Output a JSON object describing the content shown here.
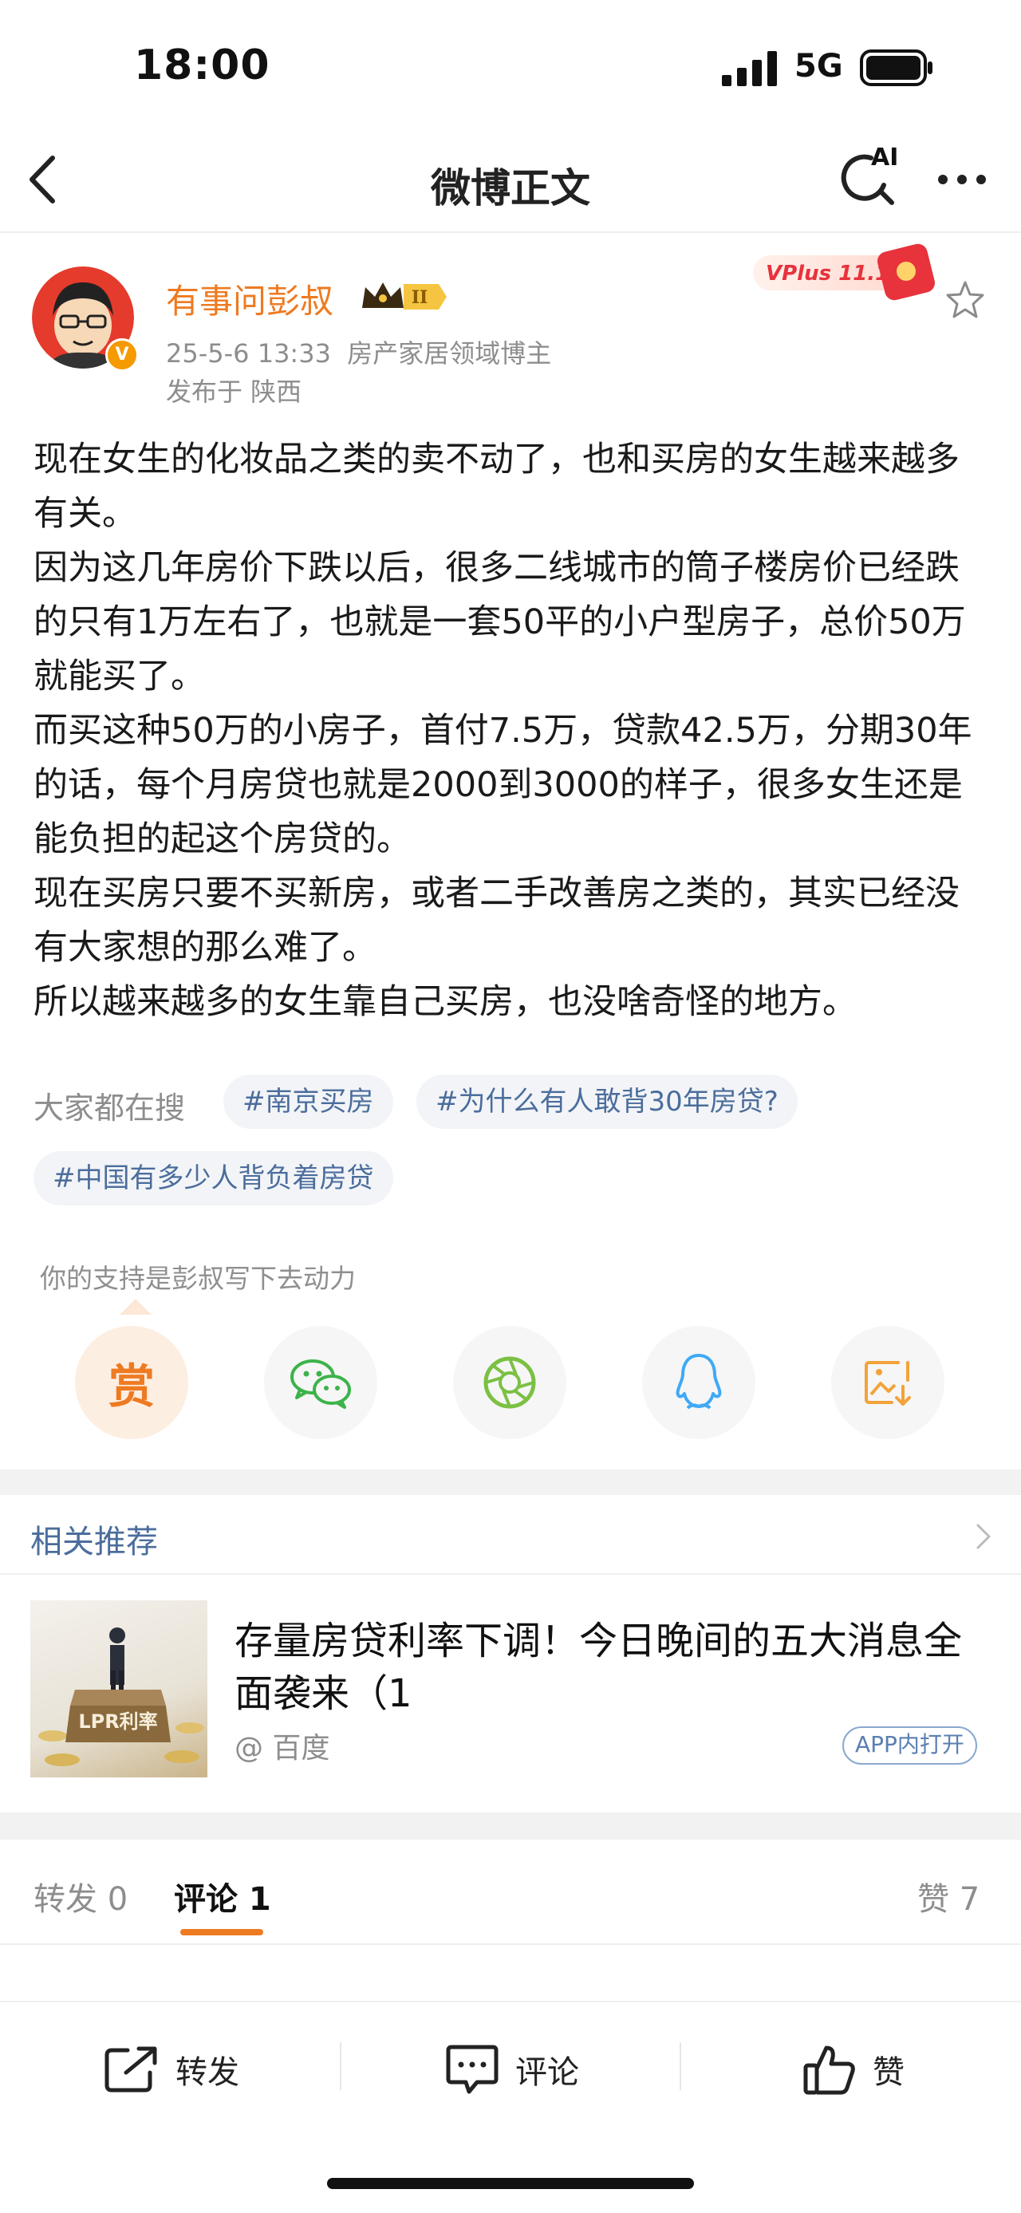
{
  "status_bar": {
    "time": "18:00",
    "network": "5G"
  },
  "nav": {
    "title": "微博正文",
    "ai_label": "AI"
  },
  "author": {
    "name": "有事问彭叔",
    "level_badge": "II",
    "verified_badge": "V",
    "timestamp": "25-5-6 13:33",
    "tagline": "房产家居领域博主",
    "location": "发布于 陕西",
    "promo_badge": "VPlus 11.11"
  },
  "post": {
    "paragraphs": [
      "现在女生的化妆品之类的卖不动了，也和买房的女生越来越多有关。",
      "因为这几年房价下跌以后，很多二线城市的筒子楼房价已经跌的只有1万左右了，也就是一套50平的小户型房子，总价50万就能买了。",
      "而买这种50万的小房子，首付7.5万，贷款42.5万，分期30年的话，每个月房贷也就是2000到3000的样子，很多女生还是能负担的起这个房贷的。",
      "现在买房只要不买新房，或者二手改善房之类的，其实已经没有大家想的那么难了。",
      "所以越来越多的女生靠自己买房，也没啥奇怪的地方。"
    ]
  },
  "search": {
    "label": "大家都在搜",
    "tags": [
      "#南京买房",
      "#为什么有人敢背30年房贷?",
      "#中国有多少人背负着房贷"
    ]
  },
  "support": {
    "label": "你的支持是彭叔写下去动力",
    "reward_label": "赏"
  },
  "related": {
    "title": "相关推荐",
    "headline": "存量房贷利率下调！今日晚间的五大消息全面袭来（1",
    "source": "@ 百度",
    "open_app_label": "APP内打开",
    "thumb_text": "LPR利率"
  },
  "tabs": {
    "repost": "转发 0",
    "comment": "评论 1",
    "like": "赞 7"
  },
  "bottom_bar": {
    "repost": "转发",
    "comment": "评论",
    "like": "赞"
  },
  "colors": {
    "accent": "#ee7a21",
    "link": "#4b6d9c",
    "muted": "#8d8d8d"
  }
}
